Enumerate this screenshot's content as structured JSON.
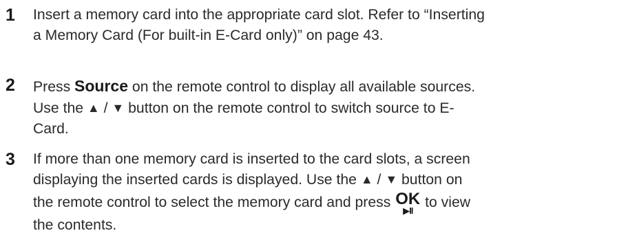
{
  "steps": [
    {
      "number": "1",
      "lines": [
        "Insert a memory card into the appropriate card slot. Refer to “Inserting",
        "a Memory Card (For built-in E-Card only)” on page 43."
      ]
    },
    {
      "number": "2",
      "line1_pre": "Press ",
      "line1_keyword": "Source",
      "line1_post": " on the remote control to display all available sources.",
      "line2_pre": "Use the ",
      "up_arrow": "▲",
      "slash": " / ",
      "down_arrow": "▼",
      "line2_post": " button on the remote control to switch source to E-",
      "line3": "Card."
    },
    {
      "number": "3",
      "line1": "If more than one memory card is inserted to the card slots, a screen",
      "line2_pre": "displaying the inserted cards is displayed. Use the ",
      "up_arrow": "▲",
      "slash": " / ",
      "down_arrow": "▼",
      "line2_post": " button on",
      "line3_pre": "the remote control to select the memory card and press ",
      "ok_label": "OK",
      "ok_subsymbol": "▶II",
      "line3_post": " to view",
      "line4": "the contents."
    }
  ]
}
